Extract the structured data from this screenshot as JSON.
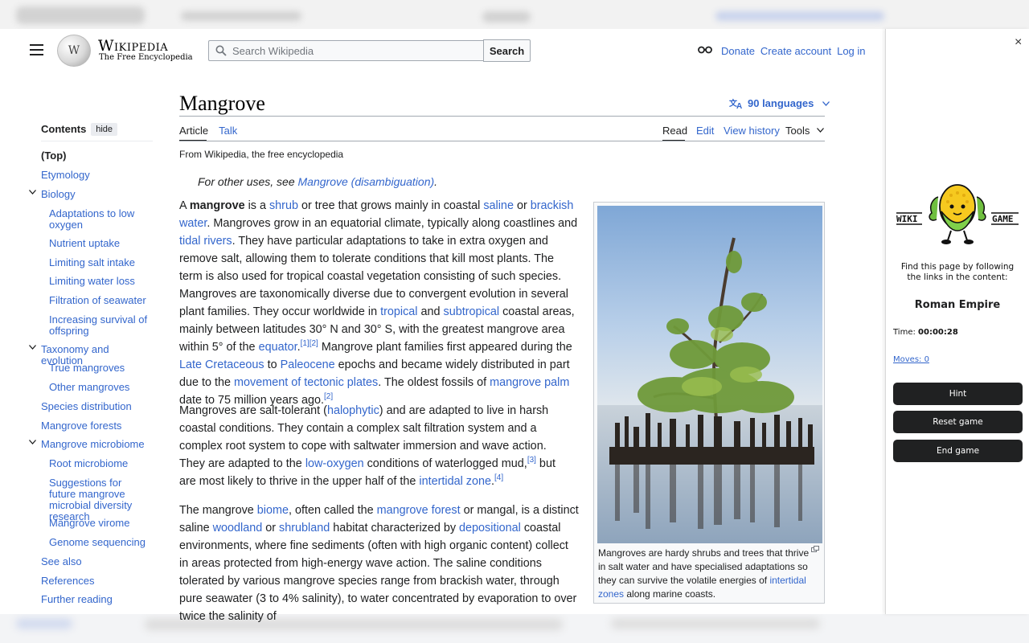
{
  "header": {
    "wordmark": "Wikipedia",
    "tagline": "The Free Encyclopedia",
    "search_placeholder": "Search Wikipedia",
    "search_button": "Search",
    "links": [
      "Donate",
      "Create account",
      "Log in"
    ]
  },
  "toc": {
    "title": "Contents",
    "hide": "hide",
    "items": [
      "(Top)",
      "Etymology",
      "Biology",
      "Adaptations to low oxygen",
      "Nutrient uptake",
      "Limiting salt intake",
      "Limiting water loss",
      "Filtration of seawater",
      "Increasing survival of offspring",
      "Taxonomy and evolution",
      "True mangroves",
      "Other mangroves",
      "Species distribution",
      "Mangrove forests",
      "Mangrove microbiome",
      "Root microbiome",
      "Suggestions for future mangrove microbial diversity research",
      "Mangrove virome",
      "Genome sequencing",
      "See also",
      "References",
      "Further reading"
    ]
  },
  "article": {
    "title": "Mangrove",
    "languages": "90 languages",
    "tabs_left": [
      "Article",
      "Talk"
    ],
    "tabs_right": [
      "Read",
      "Edit",
      "View history",
      "Tools"
    ],
    "from": "From Wikipedia, the free encyclopedia",
    "hatnote_pre": "For other uses, see ",
    "hatnote_link": "Mangrove (disambiguation)",
    "hatnote_post": ".",
    "p1": {
      "a": "A ",
      "b": "mangrove",
      "c": " is a ",
      "shrub": "shrub",
      "d": " or tree that grows mainly in coastal ",
      "saline": "saline",
      "e": " or ",
      "brackish": "brackish water",
      "f": ". Mangroves grow in an equatorial climate, typically along coastlines and ",
      "tidal": "tidal rivers",
      "g": ". They have particular adaptations to take in extra oxygen and remove salt, allowing them to tolerate conditions that kill most plants. The term is also used for tropical coastal vegetation consisting of such species. Mangroves are taxonomically diverse due to convergent evolution in several plant families. They occur worldwide in ",
      "tropical": "tropical",
      "h": " and ",
      "subtropical": "subtropical",
      "i": " coastal areas, mainly between latitudes 30° N and 30° S, with the greatest mangrove area within 5° of the ",
      "equator": "equator",
      "j": ".",
      "ref1": "[1]",
      "ref2": "[2]",
      "k": " Mangrove plant families first appeared during the ",
      "late": "Late Cretaceous",
      "l": " to ",
      "paleocene": "Paleocene",
      "m": " epochs and became widely distributed in part due to the ",
      "tectonic": "movement of tectonic plates",
      "n": ". The oldest fossils of ",
      "palm": "mangrove palm",
      "o": " date to 75 million years ago.",
      "ref3": "[2]"
    },
    "p2": {
      "a": "Mangroves are salt-tolerant (",
      "halo": "halophytic",
      "b": ") and are adapted to live in harsh coastal conditions. They contain a complex salt filtration system and a complex root system to cope with saltwater immersion and wave action. They are adapted to the ",
      "lowox": "low-oxygen",
      "c": " conditions of waterlogged mud,",
      "ref1": "[3]",
      "d": " but are most likely to thrive in the upper half of the ",
      "inter": "intertidal zone",
      "e": ".",
      "ref2": "[4]"
    },
    "p3": {
      "a": "The mangrove ",
      "biome": "biome",
      "b": ", often called the ",
      "forest": "mangrove forest",
      "c": " or mangal, is a distinct saline ",
      "woodland": "woodland",
      "d": " or ",
      "shrubland": "shrubland",
      "e": " habitat characterized by ",
      "depo": "depositional",
      "f": " coastal environments, where fine sediments (often with high organic content) collect in areas protected from high-energy wave action. The saline conditions tolerated by various mangrove species range from brackish water, through pure seawater (3 to 4% salinity), to water concentrated by evaporation to over twice the salinity of"
    },
    "caption": {
      "a": "Mangroves are hardy shrubs and trees that thrive in salt water and have specialised adaptations so they can survive the volatile energies of ",
      "link": "intertidal zones",
      "b": " along marine coasts."
    }
  },
  "panel": {
    "logo_left": "WIKI",
    "logo_right": "GAME",
    "instruction": "Find this page by following the links in the content:",
    "target": "Roman Empire",
    "time_label": "Time:",
    "time_value": "00:00:28",
    "moves": "Moves: 0",
    "buttons": [
      "Hint",
      "Reset game",
      "End game"
    ],
    "close": "×"
  },
  "colors": {
    "link": "#3366cc",
    "text": "#202122",
    "button": "#202122"
  }
}
